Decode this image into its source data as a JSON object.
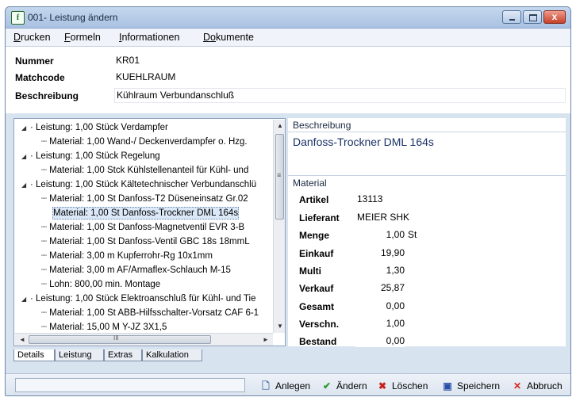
{
  "window": {
    "app_icon_glyph": "f",
    "title": "001- Leistung ändern",
    "close_glyph": "x"
  },
  "menu": {
    "items": [
      {
        "mnemonic": "D",
        "rest": "rucken"
      },
      {
        "mnemonic": "F",
        "rest": "ormeln"
      },
      {
        "mnemonic": "I",
        "rest": "nformationen"
      },
      {
        "mnemonic": "Do",
        "rest": "kumente"
      }
    ]
  },
  "header": {
    "nummer_label": "Nummer",
    "nummer_value": "KR01",
    "matchcode_label": "Matchcode",
    "matchcode_value": "KUEHLRAUM",
    "beschreibung_label": "Beschreibung",
    "beschreibung_value": "Kühlraum Verbundanschluß"
  },
  "tree": {
    "rows": [
      "Leistung: 1,00 Stück Verdampfer",
      "Material: 1,00  Wand-/ Deckenverdampfer o. Hzg.",
      "Leistung: 1,00 Stück Regelung",
      "Material: 1,00 Stck Kühlstellenanteil für Kühl- und",
      "Leistung: 1,00 Stück Kältetechnischer Verbundanschlü",
      "Material: 1,00 St Danfoss-T2 Düseneinsatz Gr.02",
      "Material: 1,00 St Danfoss-Trockner DML 164s",
      "Material: 1,00 St Danfoss-Magnetventil EVR 3-B",
      "Material: 1,00 St Danfoss-Ventil GBC 18s  18mmL",
      "Material: 3,00 m Kupferrohr-Rg  10x1mm",
      "Material: 3,00 m AF/Armaflex-Schlauch M-15",
      "Lohn: 800,00 min. Montage",
      "Leistung: 1,00 Stück Elektroanschluß für Kühl- und Tie",
      "Material: 1,00 St ABB-Hilfsschalter-Vorsatz CAF 6-1",
      "Material: 15,00 M Y-JZ  3X1,5"
    ],
    "scroll_up": "▲",
    "scroll_down": "▼",
    "scroll_left": "◄",
    "scroll_right": "►",
    "thumb_grip": "≡",
    "hthumb_grip": "III"
  },
  "detail": {
    "beschreibung_group": "Beschreibung",
    "beschreibung_value": "Danfoss-Trockner DML 164s",
    "material_group": "Material",
    "artikel_label": "Artikel",
    "artikel_value": "13113",
    "lieferant_label": "Lieferant",
    "lieferant_value": "MEIER SHK",
    "menge_label": "Menge",
    "menge_value": "1,00",
    "menge_unit": "St",
    "einkauf_label": "Einkauf",
    "einkauf_value": "19,90",
    "multi_label": "Multi",
    "multi_value": "1,30",
    "verkauf_label": "Verkauf",
    "verkauf_value": "25,87",
    "gesamt_label": "Gesamt",
    "gesamt_value": "0,00",
    "verschn_label": "Verschn.",
    "verschn_value": "1,00",
    "bestand_label": "Bestand",
    "bestand_value": "0,00"
  },
  "tabs": [
    "Details",
    "Leistung",
    "Extras",
    "Kalkulation"
  ],
  "toolbar": {
    "anlegen": "Anlegen",
    "aendern": "Ändern",
    "loeschen": "Löschen",
    "speichern": "Speichern",
    "abbruch": "Abbruch"
  },
  "colors": {
    "accent_green": "#2e9a2e",
    "delete_red": "#c8201a",
    "save_blue": "#2a4fa8",
    "cancel_red": "#d4261c"
  }
}
